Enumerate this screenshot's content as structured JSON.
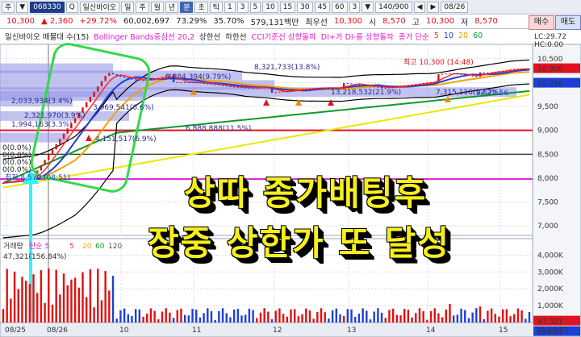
{
  "toolbar": {
    "items": [
      "주",
      "▼",
      "068330",
      "Q",
      "일신바이오",
      "일",
      "주",
      "월",
      "년",
      "분",
      "초",
      "틱",
      "1",
      "3",
      "5",
      "10",
      "15",
      "30",
      "45",
      "60",
      "3",
      "▼",
      "140/900",
      "◀",
      "▶",
      "08/26"
    ]
  },
  "quote": {
    "price": "10,300",
    "change": "▲ 2,360",
    "change_pct": "+29.72%",
    "volume": "60,002,697",
    "turnover_pct": "73.29%",
    "vol_ratio": "35.70%",
    "amount": "579,131백만",
    "best_ask_label": "최우선",
    "price2": "10,300",
    "open_label": "시",
    "open": "8,570",
    "high_label": "고",
    "high": "10,300",
    "low_label": "저",
    "low": "8,570",
    "buy_label": "매수",
    "sell_label": "매도"
  },
  "legend": {
    "title": "일신바이오 매물대 수(15)",
    "bollinger": "Bollinger Bands중심선 20,2",
    "upper": "상한선",
    "lower": "하한선",
    "cci": "CCI기준선 상향돌파",
    "di": "DI+가 DI-를 상향돌파",
    "ma": "종가 단순",
    "ma_periods": [
      "5",
      "10",
      "20",
      "60"
    ],
    "lc": "LC:29.72",
    "hc": "HC:0.00"
  },
  "colors": {
    "ma5": "#ff2a2a",
    "ma10": "#1d3fd6",
    "ma20": "#f2a300",
    "ma60": "#109a2c",
    "ma120": "#e8e800",
    "volume_up": "#e01010",
    "volume_down": "#1d3fd6",
    "overlay_text": "#f7ef1c",
    "box": "#34d84a",
    "bollinger": "#000000",
    "level_line_red": "#e0102a",
    "level_line_magenta": "#e020d0",
    "arrow": "#2ff6f6"
  },
  "annotations": {
    "high_note": "최고 10,300 (14:48)",
    "profile_labels": [
      "8,321,733(13.8%)",
      "5,884,394(9.79%)",
      "2,033,934(3.4%)",
      "3,969,541(6.6%)",
      "2,321,970(3.9%)",
      "1,994,163(3.3%)",
      "4,151,517(6.9%)",
      "6,888,888(11.5%)",
      "13,218,532(21.9%)",
      "7,315,116(12.2%)"
    ],
    "left_pcts": [
      "0(0.0%)",
      "0(0.0%)",
      "0(0.0%)",
      "0(0.0%)"
    ],
    "low_marker": "최저 8,570 (08:51)",
    "low_value": "9,670.56",
    "volume_title": "거래량",
    "volume_ma": "단순 5",
    "volume_ma_periods": [
      "5",
      "20",
      "60",
      "120"
    ],
    "volume_stats": "47,321(156.84%)"
  },
  "price_axis": {
    "labels": [
      "10,500",
      "10,000",
      "9,500",
      "9,000",
      "8,500",
      "8,000",
      "7,500",
      "7,000"
    ],
    "current_tag": "10,300",
    "ma_tag": "10,216"
  },
  "volume_axis": {
    "labels": [
      "4,000K",
      "3,000K",
      "2,000K",
      "1,000K"
    ],
    "current_tag": "47,321",
    "ma_tag": "156,84"
  },
  "time_axis": {
    "labels": [
      "08/25",
      "08/26",
      "10",
      "11",
      "12",
      "13",
      "14",
      "15"
    ],
    "time_tag": "15:30:01"
  },
  "overlay": {
    "line1": "상따 종가배팅후",
    "line2": "장중 상한가 또 달성"
  }
}
